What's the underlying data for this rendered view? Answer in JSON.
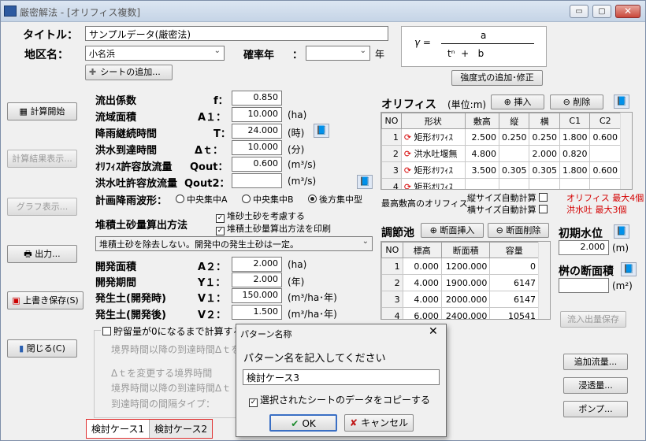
{
  "window": {
    "title": "厳密解法 - [オリフィス複数]",
    "min": "▭",
    "max": "▢",
    "close": "✕"
  },
  "header": {
    "title_label": "タイトル：",
    "title_value": "サンプルデータ(厳密法)",
    "region_label": "地区名：",
    "region_value": "小名浜",
    "return_label": "確率年",
    "return_colon": "：",
    "return_value": "",
    "return_unit": "年",
    "add_sheet_label": "シートの追加...",
    "formula_gamma": "γ =",
    "formula_a": "a",
    "formula_denominator": "tⁿ  +   b",
    "intensity_button": "強度式の追加･修正"
  },
  "sidebar": {
    "calc_start": "計算開始",
    "calc_result": "計算結果表示...",
    "graph": "グラフ表示...",
    "output": "出力...",
    "overwrite": "上書き保存(S)",
    "close": "閉じる(C)"
  },
  "params": {
    "runoff": {
      "label": "流出係数",
      "sym": "f：",
      "value": "0.850",
      "unit": ""
    },
    "area": {
      "label": "流域面積",
      "sym": "A１：",
      "value": "10.000",
      "unit": "(ha)"
    },
    "rain": {
      "label": "降雨継続時間",
      "sym": "T：",
      "value": "24.000",
      "unit": "(時)"
    },
    "flood": {
      "label": "洪水到達時間",
      "sym": "Δｔ：",
      "value": "10.000",
      "unit": "(分)"
    },
    "qout": {
      "label": "ｵﾘﾌｨｽ許容放流量",
      "sym": "Qout：",
      "value": "0.600",
      "unit": "(m³/s)"
    },
    "qout2": {
      "label": "洪水吐許容放流量",
      "sym": "Qout2：",
      "value": "",
      "unit": "(m³/s)"
    },
    "wave_label": "計画降雨波形：",
    "wave_a": "中央集中A",
    "wave_b": "中央集中B",
    "wave_c": "後方集中型",
    "sediment_label": "堆積土砂量算出方法",
    "sediment_chk1": "堆砂土砂を考慮する",
    "sediment_chk2": "堆積土砂量算出方法を印刷",
    "sediment_combo": "堆積土砂を除去しない。開発中の発生土砂は一定。",
    "dev_area": {
      "label": "開発面積",
      "sym": "A２：",
      "value": "2.000",
      "unit": "(ha)"
    },
    "dev_period": {
      "label": "開発期間",
      "sym": "Y１：",
      "value": "2.000",
      "unit": "(年)"
    },
    "soil_during": {
      "label": "発生土(開発時)",
      "sym": "V１：",
      "value": "150.000",
      "unit": "(m³/ha･年)"
    },
    "soil_after": {
      "label": "発生土(開発後)",
      "sym": "V２：",
      "value": "1.500",
      "unit": "(m³/ha･年)"
    },
    "storage_chk": "貯留量が0になるまで計算する",
    "g1": "境界時間以降の到達時間Δｔを",
    "g2": "Δｔを変更する境界時間",
    "g3": "境界時間以降の到達時間Δｔ",
    "g4": "到達時間の間隔タイプ："
  },
  "orifice": {
    "title": "オリフィス",
    "unit": "(単位:m)",
    "insert": "挿入",
    "delete": "削除",
    "headers": [
      "NO",
      "形状",
      "敷高",
      "縦",
      "横",
      "C1",
      "C2"
    ],
    "rows": [
      [
        "1",
        "矩形ｵﾘﾌｨｽ",
        "2.500",
        "0.250",
        "0.250",
        "1.800",
        "0.600"
      ],
      [
        "2",
        "洪水吐堰無",
        "4.800",
        "",
        "2.000",
        "0.820",
        ""
      ],
      [
        "3",
        "矩形ｵﾘﾌｨｽ",
        "3.500",
        "0.305",
        "0.305",
        "1.800",
        "0.600"
      ],
      [
        "4",
        "矩形ｵﾘﾌｨｽ",
        "",
        "",
        "",
        "",
        ""
      ]
    ],
    "highest": "最高敷高のオリフィス",
    "vauto": "縦サイズ自動計算",
    "hauto": "横サイズ自動計算",
    "max_orifice": "オリフィス 最大4個",
    "max_spill": "洪水吐 最大3個"
  },
  "pond": {
    "title": "調節池",
    "insert": "断面挿入",
    "delete": "断面削除",
    "headers": [
      "NO",
      "標高",
      "断面積",
      "容量"
    ],
    "rows": [
      [
        "1",
        "0.000",
        "1200.000",
        "0"
      ],
      [
        "2",
        "4.000",
        "1900.000",
        "6147"
      ],
      [
        "3",
        "4.000",
        "2000.000",
        "6147"
      ],
      [
        "4",
        "6.000",
        "2400.000",
        "10541"
      ]
    ]
  },
  "initial": {
    "label": "初期水位",
    "value": "2.000",
    "unit": "(m)"
  },
  "weir": {
    "label": "桝の断面積",
    "value": "",
    "unit": "(m²)"
  },
  "right_buttons": {
    "inout_save": "流入出量保存",
    "add_flow": "追加流量...",
    "seep": "浸透量...",
    "pump": "ポンプ..."
  },
  "tabs": [
    "検討ケース1",
    "検討ケース2"
  ],
  "dialog": {
    "title": "パターン名称",
    "close": "✕",
    "prompt": "パターン名を記入してください",
    "value": "検討ケース3",
    "copy_chk": "選択されたシートのデータをコピーする",
    "ok": "OK",
    "cancel": "キャンセル"
  },
  "colors": {
    "accent_red": "#d40000",
    "title_grey": "#555555"
  }
}
